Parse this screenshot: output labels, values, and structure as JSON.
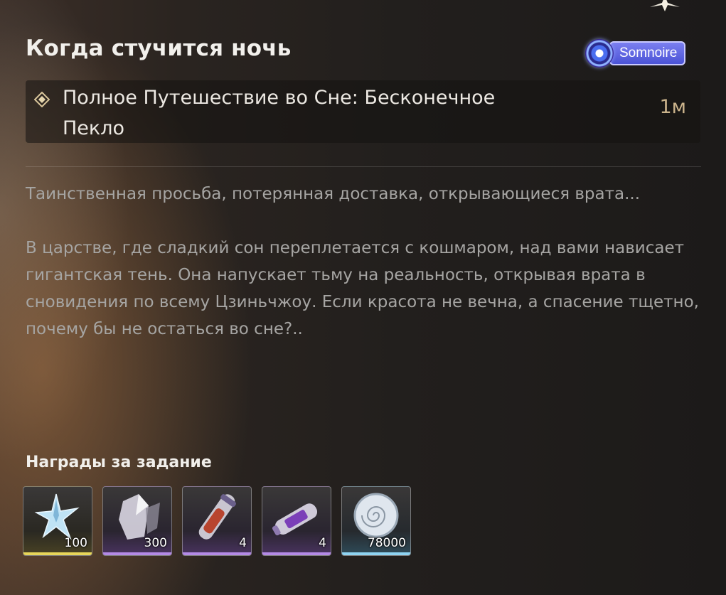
{
  "quest": {
    "title": "Когда стучится ночь",
    "badge_label": "Somnoire",
    "badge_icon": "somnoire-swirl-icon",
    "objective_name": "Полное Путешествие во Сне: Бесконечное Пекло",
    "objective_level": "1м",
    "description_1": "Таинственная просьба, потерянная доставка, открывающиеся врата...",
    "description_2": "В царстве, где сладкий сон переплетается с кошмаром, над вами нависает гигантская тень. Она напускает тьму на реальность, открывая врата в сновидения по всему Цзиньчжоу. Если красота не вечна, а спасение тщетно, почему бы не остаться во сне?.."
  },
  "rewards": {
    "title": "Награды за задание",
    "items": [
      {
        "icon": "crystal-star-icon",
        "count": "100",
        "rarity_color": "#e7d65a"
      },
      {
        "icon": "crystal-shard-icon",
        "count": "300",
        "rarity_color": "#b48ae6"
      },
      {
        "icon": "energy-vial-icon",
        "count": "4",
        "rarity_color": "#b48ae6"
      },
      {
        "icon": "capsule-icon",
        "count": "4",
        "rarity_color": "#b48ae6"
      },
      {
        "icon": "shell-coin-icon",
        "count": "78000",
        "rarity_color": "#8fd4f2"
      }
    ]
  },
  "colors": {
    "accent_gold": "#cbb48c",
    "badge_blue": "#5b61e0"
  }
}
